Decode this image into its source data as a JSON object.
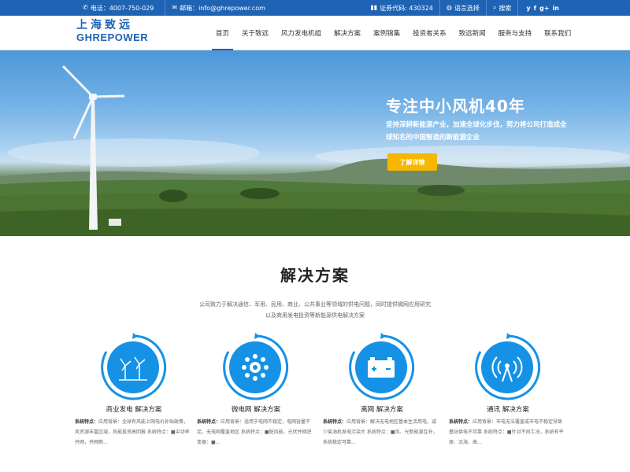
{
  "topbar": {
    "phone": "电话：4007-750-029",
    "email": "邮箱：info@ghrepower.com",
    "stock": "证券代码: 430324",
    "language": "语言选择",
    "search": "搜索",
    "social": [
      "y",
      "f",
      "g+",
      "in"
    ]
  },
  "logo": {
    "cn": "上海致远",
    "en": "GHREPOWER"
  },
  "nav": [
    "首页",
    "关于致远",
    "风力发电机组",
    "解决方案",
    "案例锦集",
    "投资者关系",
    "致远新闻",
    "服务与支持",
    "联系我们"
  ],
  "hero": {
    "title": "专注中小风机40年",
    "subtitle": "坚持深耕新能源产业，加速全球化步伐，努力将公司打造成全球知名的中国智造的新能源企业",
    "button": "了解详情"
  },
  "solutions": {
    "title": "解决方案",
    "description_line1": "公司致力于解决通信、军用、民用、商业、公共事业等领域的供电问题，同时提供微网应用研究",
    "description_line2": "以及商用发电投资等新能源供电解决方案",
    "cards": [
      {
        "icon": "wind-turbine-icon",
        "name": "商业发电 解决方案",
        "label": "系统特点：",
        "text": "应用背景：全球有风能上网电价补贴政策，风资源丰富区域，风能投资高回报  系统特点：■中功率并网，并网侧…"
      },
      {
        "icon": "sun-gear-icon",
        "name": "微电网 解决方案",
        "label": "系统特点：",
        "text": "应用背景：适用于电网不稳定，电网容量不足，无电网覆盖地区  系统特点：■配风能、光伏并网逆变器：■…"
      },
      {
        "icon": "battery-icon",
        "name": "离网 解决方案",
        "label": "系统特点：",
        "text": "应用背景：解决无电地区基本生活用电，减少柴油机发电污染大  系统特点：■风、光新能源互补，系统稳定可靠…"
      },
      {
        "icon": "signal-tower-icon",
        "name": "通讯 解决方案",
        "label": "系统特点：",
        "text": "应用背景：市电无法覆盖或市电不稳定导致基站供电不可靠  系统特点：■针对不同工况，系统有平原、沿海、高…"
      }
    ]
  },
  "colors": {
    "brand": "#1f63b4",
    "accent": "#1592e6",
    "button": "#f5b700"
  }
}
